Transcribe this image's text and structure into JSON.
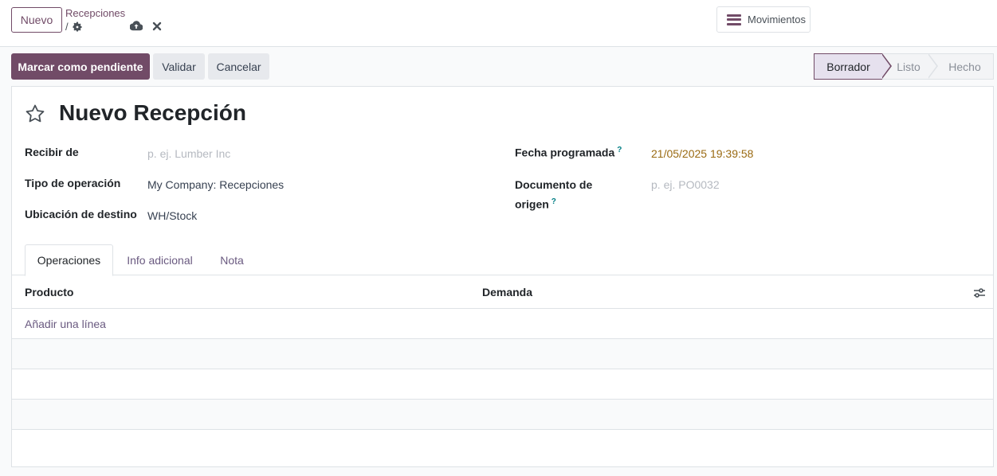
{
  "control_panel": {
    "new_button": "Nuevo",
    "breadcrumb_parent": "Recepciones",
    "breadcrumb_separator": "/",
    "movements_button": "Movimientos"
  },
  "actions": {
    "mark_todo": "Marcar como pendiente",
    "validate": "Validar",
    "cancel": "Cancelar"
  },
  "status_bar": {
    "stages": [
      "Borrador",
      "Listo",
      "Hecho"
    ],
    "current": "Borrador"
  },
  "form": {
    "title": "Nuevo Recepción",
    "fields_left": [
      {
        "label": "Recibir de",
        "value": "",
        "placeholder": "p. ej. Lumber Inc"
      },
      {
        "label": "Tipo de operación",
        "value": "My Company: Recepciones"
      },
      {
        "label": "Ubicación de destino",
        "value": "WH/Stock"
      }
    ],
    "fields_right": [
      {
        "label": "Fecha programada",
        "help": "?",
        "value": "21/05/2025 19:39:58"
      },
      {
        "label_line1": "Documento de",
        "label_line2": "origen",
        "help": "?",
        "value": "",
        "placeholder": "p. ej. PO0032"
      }
    ]
  },
  "tabs": [
    "Operaciones",
    "Info adicional",
    "Nota"
  ],
  "table": {
    "columns": [
      "Producto",
      "Demanda"
    ],
    "add_line": "Añadir una línea"
  },
  "colors": {
    "primary": "#714b67",
    "date_text": "#9a6a12",
    "help_text": "#017e84"
  },
  "icons": [
    "gear-icon",
    "cloud-upload-icon",
    "close-icon",
    "hamburger-icon",
    "star-icon",
    "column-settings-icon"
  ]
}
